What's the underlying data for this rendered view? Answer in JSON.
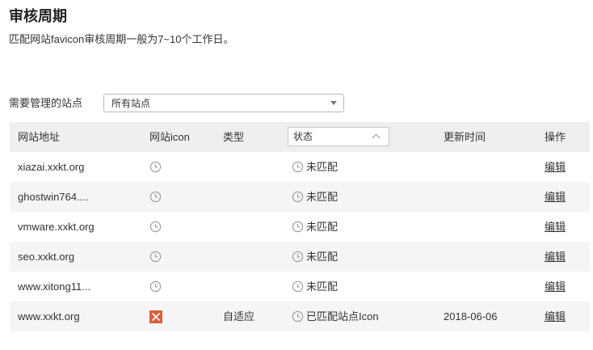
{
  "page": {
    "title": "审核周期",
    "description": "匹配网站favicon审核周期一般为7~10个工作日。"
  },
  "filter": {
    "label": "需要管理的站点",
    "selected": "所有站点"
  },
  "table": {
    "headers": {
      "site": "网站地址",
      "icon": "网站icon",
      "type": "类型",
      "status": "状态",
      "time": "更新时间",
      "op": "操作"
    },
    "rows": [
      {
        "site": "xiazai.xxkt.org",
        "icon": "clock-icon",
        "type": "",
        "status": "未匹配",
        "time": "",
        "op": "编辑"
      },
      {
        "site": "ghostwin764....",
        "icon": "clock-icon",
        "type": "",
        "status": "未匹配",
        "time": "",
        "op": "编辑"
      },
      {
        "site": "vmware.xxkt.org",
        "icon": "clock-icon",
        "type": "",
        "status": "未匹配",
        "time": "",
        "op": "编辑"
      },
      {
        "site": "seo.xxkt.org",
        "icon": "clock-icon",
        "type": "",
        "status": "未匹配",
        "time": "",
        "op": "编辑"
      },
      {
        "site": "www.xitong11...",
        "icon": "clock-icon",
        "type": "",
        "status": "未匹配",
        "time": "",
        "op": "编辑"
      },
      {
        "site": "www.xxkt.org",
        "icon": "site-favicon",
        "type": "自适应",
        "status": "已匹配站点Icon",
        "time": "2018-06-06",
        "op": "编辑"
      }
    ]
  },
  "colors": {
    "header_bg": "#efefef",
    "alt_row_bg": "#f5f5f5",
    "favicon": "#d9603b"
  }
}
